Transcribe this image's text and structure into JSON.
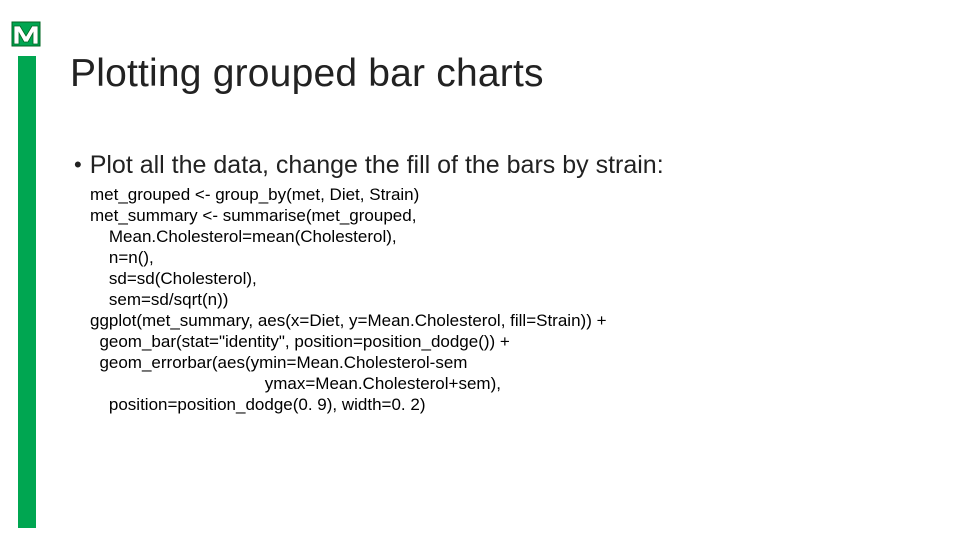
{
  "title": "Plotting grouped bar charts",
  "bullet": "Plot all the data, change the fill of the bars by strain:",
  "code": "met_grouped <- group_by(met, Diet, Strain)\nmet_summary <- summarise(met_grouped,\n    Mean.Cholesterol=mean(Cholesterol),\n    n=n(),\n    sd=sd(Cholesterol),\n    sem=sd/sqrt(n))\nggplot(met_summary, aes(x=Diet, y=Mean.Cholesterol, fill=Strain)) +\n  geom_bar(stat=\"identity\", position=position_dodge()) +\n  geom_errorbar(aes(ymin=Mean.Cholesterol-sem\n                                     ymax=Mean.Cholesterol+sem),\n    position=position_dodge(0. 9), width=0. 2)"
}
